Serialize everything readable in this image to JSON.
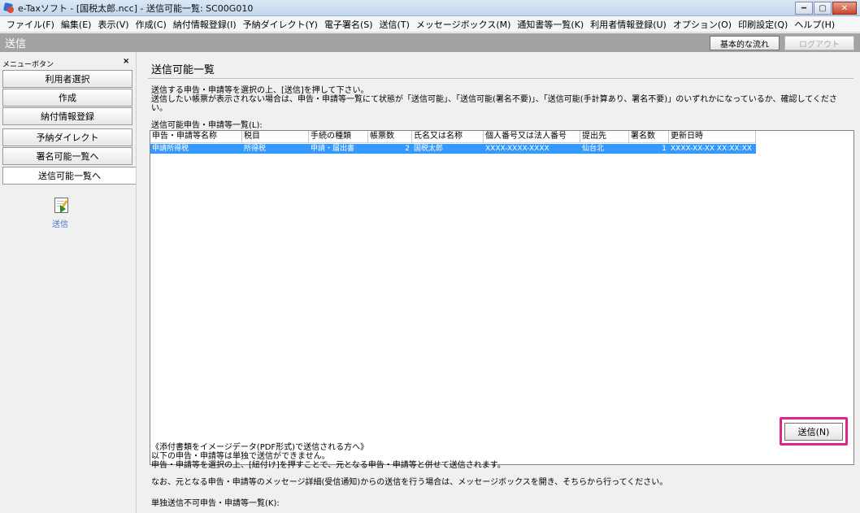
{
  "window": {
    "title": "e-Taxソフト - [国税太郎.ncc] - 送信可能一覧: SC00G010",
    "minimize_label": "━",
    "maximize_label": "▢",
    "close_label": "✕"
  },
  "menubar": {
    "items": [
      "ファイル(F)",
      "編集(E)",
      "表示(V)",
      "作成(C)",
      "納付情報登録(I)",
      "予納ダイレクト(Y)",
      "電子署名(S)",
      "送信(T)",
      "メッセージボックス(M)",
      "通知書等一覧(K)",
      "利用者情報登録(U)",
      "オプション(O)",
      "印刷設定(Q)",
      "ヘルプ(H)"
    ]
  },
  "section": {
    "title": "送信",
    "flow_button": "基本的な流れ",
    "logout_button": "ログアウト"
  },
  "sidebar": {
    "heading": "メニューボタン",
    "close_label": "×",
    "items": [
      "利用者選択",
      "作成",
      "納付情報登録",
      "予納ダイレクト",
      "署名可能一覧へ",
      "送信可能一覧へ"
    ],
    "send_label": "送信"
  },
  "main": {
    "page_title": "送信可能一覧",
    "instruction_1": "送信する申告・申請等を選択の上、[送信]を押して下さい。",
    "instruction_2": "送信したい帳票が表示されない場合は、申告・申請等一覧にて状態が「送信可能」、「送信可能(署名不要)」、「送信可能(手計算あり、署名不要)」のいずれかになっているか、確認してください。",
    "list_label": "送信可能申告・申請等一覧(L):",
    "columns": [
      "申告・申請等名称",
      "税目",
      "手続の種類",
      "帳票数",
      "氏名又は名称",
      "個人番号又は法人番号",
      "提出先",
      "署名数",
      "更新日時"
    ],
    "rows": [
      [
        "申請所得税",
        "所得税",
        "申請・届出書",
        "2",
        "国税太郎",
        "XXXX-XXXX-XXXX",
        "仙台北",
        "1",
        "XXXX-XX-XX XX:XX:XX"
      ]
    ],
    "send_button": "送信(N)",
    "note_1": "《添付書類をイメージデータ(PDF形式)で送信される方へ》",
    "note_2": "以下の申告・申請等は単独で送信ができません。",
    "note_3": "申告・申請等を選択の上、[紐付け]を押すことで、元となる申告・申請等と併せて送信されます。",
    "note_4": "なお、元となる申告・申請等のメッセージ詳細(受信通知)からの送信を行う場合は、メッセージボックスを開き、そちらから行ってください。",
    "list2_label": "単独送信不可申告・申請等一覧(K):"
  }
}
